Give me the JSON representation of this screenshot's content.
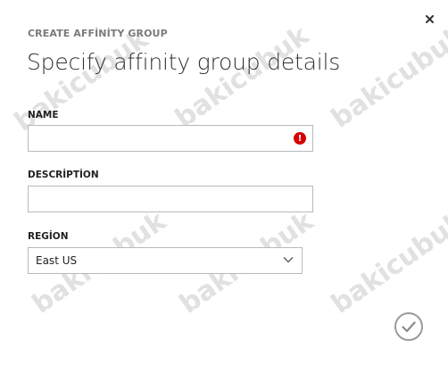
{
  "dialog": {
    "eyebrow": "CREATE AFFİNİTY GROUP",
    "title": "Specify affinity group details",
    "close_icon": "close-icon"
  },
  "fields": {
    "name": {
      "label": "NAME",
      "value": "",
      "placeholder": "",
      "status": "error"
    },
    "description": {
      "label": "DESCRİPTİON",
      "value": "",
      "placeholder": ""
    },
    "region": {
      "label": "REGİON",
      "selected": "East US"
    }
  },
  "actions": {
    "ok_icon": "checkmark-icon"
  },
  "watermark": "bakicubuk",
  "colors": {
    "error": "#d40000",
    "border": "#b9b9b9",
    "muted": "#7a7a7a"
  }
}
